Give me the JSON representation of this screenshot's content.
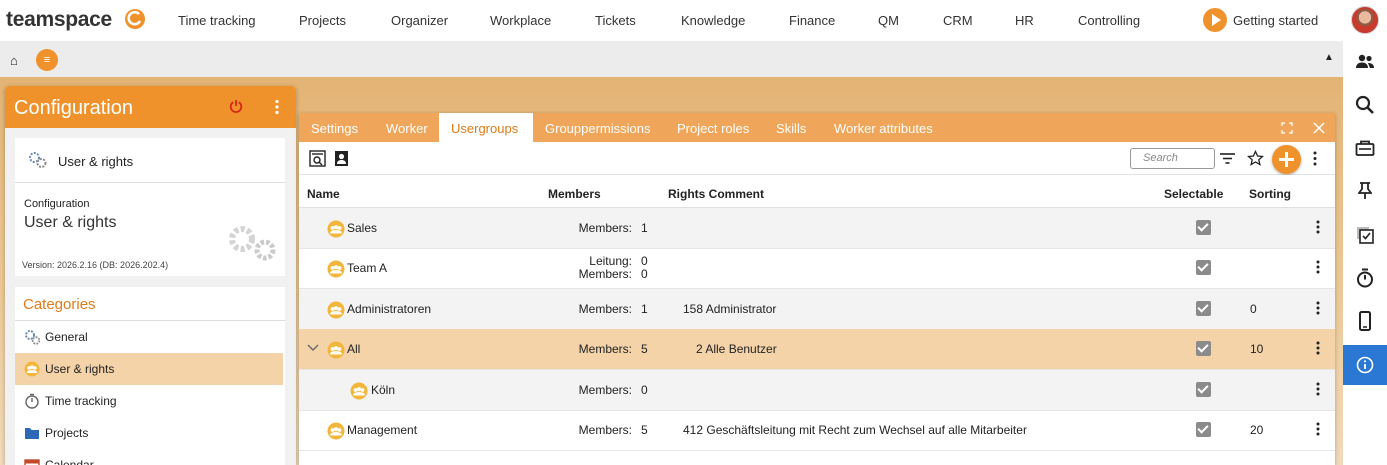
{
  "brand": {
    "name": "teamspace",
    "accent": "#f0922b"
  },
  "nav": {
    "items": [
      "Time tracking",
      "Projects",
      "Organizer",
      "Workplace",
      "Tickets",
      "Knowledge",
      "Finance",
      "QM",
      "CRM",
      "HR",
      "Controlling"
    ],
    "getting_started": "Getting started"
  },
  "subbar": {
    "home_icon": "home-icon",
    "menu_icon": "menu-icon",
    "collapse_icon": "collapse-up-icon"
  },
  "config": {
    "title": "Configuration",
    "current_item": "User & rights",
    "info_caption": "Configuration",
    "info_title": "User & rights",
    "version": "Version: 2026.2.16 (DB: 2026.202.4)",
    "categories_title": "Categories",
    "categories": [
      {
        "label": "General",
        "icon": "gears-icon",
        "selected": false
      },
      {
        "label": "User & rights",
        "icon": "usergroup-icon",
        "selected": true
      },
      {
        "label": "Time tracking",
        "icon": "stopwatch-icon",
        "selected": false
      },
      {
        "label": "Projects",
        "icon": "folder-icon",
        "selected": false
      },
      {
        "label": "Calendar",
        "icon": "calendar-icon",
        "selected": false
      }
    ]
  },
  "main": {
    "tabs": [
      {
        "label": "Settings",
        "active": false
      },
      {
        "label": "Worker",
        "active": false
      },
      {
        "label": "Usergroups",
        "active": true
      },
      {
        "label": "Grouppermissions",
        "active": false
      },
      {
        "label": "Project roles",
        "active": false
      },
      {
        "label": "Skills",
        "active": false
      },
      {
        "label": "Worker attributes",
        "active": false
      }
    ],
    "search_placeholder": "Search",
    "columns": {
      "name": "Name",
      "members": "Members",
      "rights": "Rights Comment",
      "selectable": "Selectable",
      "sorting": "Sorting"
    },
    "rows": [
      {
        "name": "Sales",
        "lines": [
          {
            "label": "Members:",
            "value": "1"
          }
        ],
        "rights": "",
        "selectable": true,
        "sorting": "",
        "indent": 0,
        "expanded": false,
        "selected": false
      },
      {
        "name": "Team A",
        "lines": [
          {
            "label": "Leitung:",
            "value": "0"
          },
          {
            "label": "Members:",
            "value": "0"
          }
        ],
        "rights": "",
        "selectable": true,
        "sorting": "",
        "indent": 0,
        "expanded": false,
        "selected": false
      },
      {
        "name": "Administratoren",
        "lines": [
          {
            "label": "Members:",
            "value": "1"
          }
        ],
        "rights": "158 Administrator",
        "selectable": true,
        "sorting": "0",
        "indent": 0,
        "expanded": false,
        "selected": false
      },
      {
        "name": "All",
        "lines": [
          {
            "label": "Members:",
            "value": "5"
          }
        ],
        "rights": "2 Alle Benutzer",
        "selectable": true,
        "sorting": "10",
        "indent": 0,
        "expanded": true,
        "selected": true
      },
      {
        "name": "Köln",
        "lines": [
          {
            "label": "Members:",
            "value": "0"
          }
        ],
        "rights": "",
        "selectable": true,
        "sorting": "",
        "indent": 1,
        "expanded": false,
        "selected": false
      },
      {
        "name": "Management",
        "lines": [
          {
            "label": "Members:",
            "value": "5"
          }
        ],
        "rights": "412 Geschäftsleitung mit Recht zum Wechsel auf alle Mitarbeiter",
        "selectable": true,
        "sorting": "20",
        "indent": 0,
        "expanded": false,
        "selected": false
      }
    ]
  },
  "rightbar": {
    "icons": [
      "people-icon",
      "search-icon",
      "inbox-icon",
      "pin-icon",
      "tasks-icon",
      "timer-icon",
      "mobile-icon",
      "info-icon"
    ],
    "active": "info-icon"
  }
}
